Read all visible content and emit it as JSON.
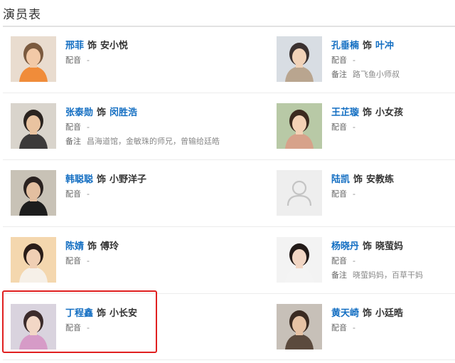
{
  "page": {
    "title": "演员表"
  },
  "labels": {
    "as": "饰",
    "dub": "配音",
    "note": "备注"
  },
  "cast": [
    {
      "actor": "邢菲",
      "role": "安小悦",
      "role_link": false,
      "dub": "-",
      "note": null,
      "photo": "person-photo"
    },
    {
      "actor": "孔垂楠",
      "role": "叶冲",
      "role_link": true,
      "dub": "-",
      "note": "路飞鱼小师叔",
      "photo": "person-photo"
    },
    {
      "actor": "张泰勋",
      "role": "闵胜浩",
      "role_link": true,
      "dub": "-",
      "note": "昌海道馆，金敏珠的师兄，曾输给廷皓",
      "photo": "person-photo"
    },
    {
      "actor": "王芷璇",
      "role": "小女孩",
      "role_link": false,
      "dub": "-",
      "note": null,
      "photo": "person-photo"
    },
    {
      "actor": "韩聪聪",
      "role": "小野洋子",
      "role_link": false,
      "dub": "-",
      "note": null,
      "photo": "person-photo"
    },
    {
      "actor": "陆凯",
      "role": "安教练",
      "role_link": false,
      "dub": "-",
      "note": null,
      "photo": "default-avatar"
    },
    {
      "actor": "陈婧",
      "role": "傅玲",
      "role_link": false,
      "dub": "-",
      "note": null,
      "photo": "person-photo"
    },
    {
      "actor": "杨晓丹",
      "role": "晓萤妈",
      "role_link": false,
      "dub": "-",
      "note": "晓萤妈妈，百草干妈",
      "photo": "person-photo"
    },
    {
      "actor": "丁程鑫",
      "role": "小长安",
      "role_link": false,
      "dub": "-",
      "note": null,
      "photo": "person-photo",
      "highlighted": true
    },
    {
      "actor": "黄天崎",
      "role": "小廷晧",
      "role_link": false,
      "dub": "-",
      "note": null,
      "photo": "person-photo"
    }
  ],
  "colors": {
    "link": "#136ec2",
    "highlight": "#e02020",
    "rule": "#ececec"
  }
}
